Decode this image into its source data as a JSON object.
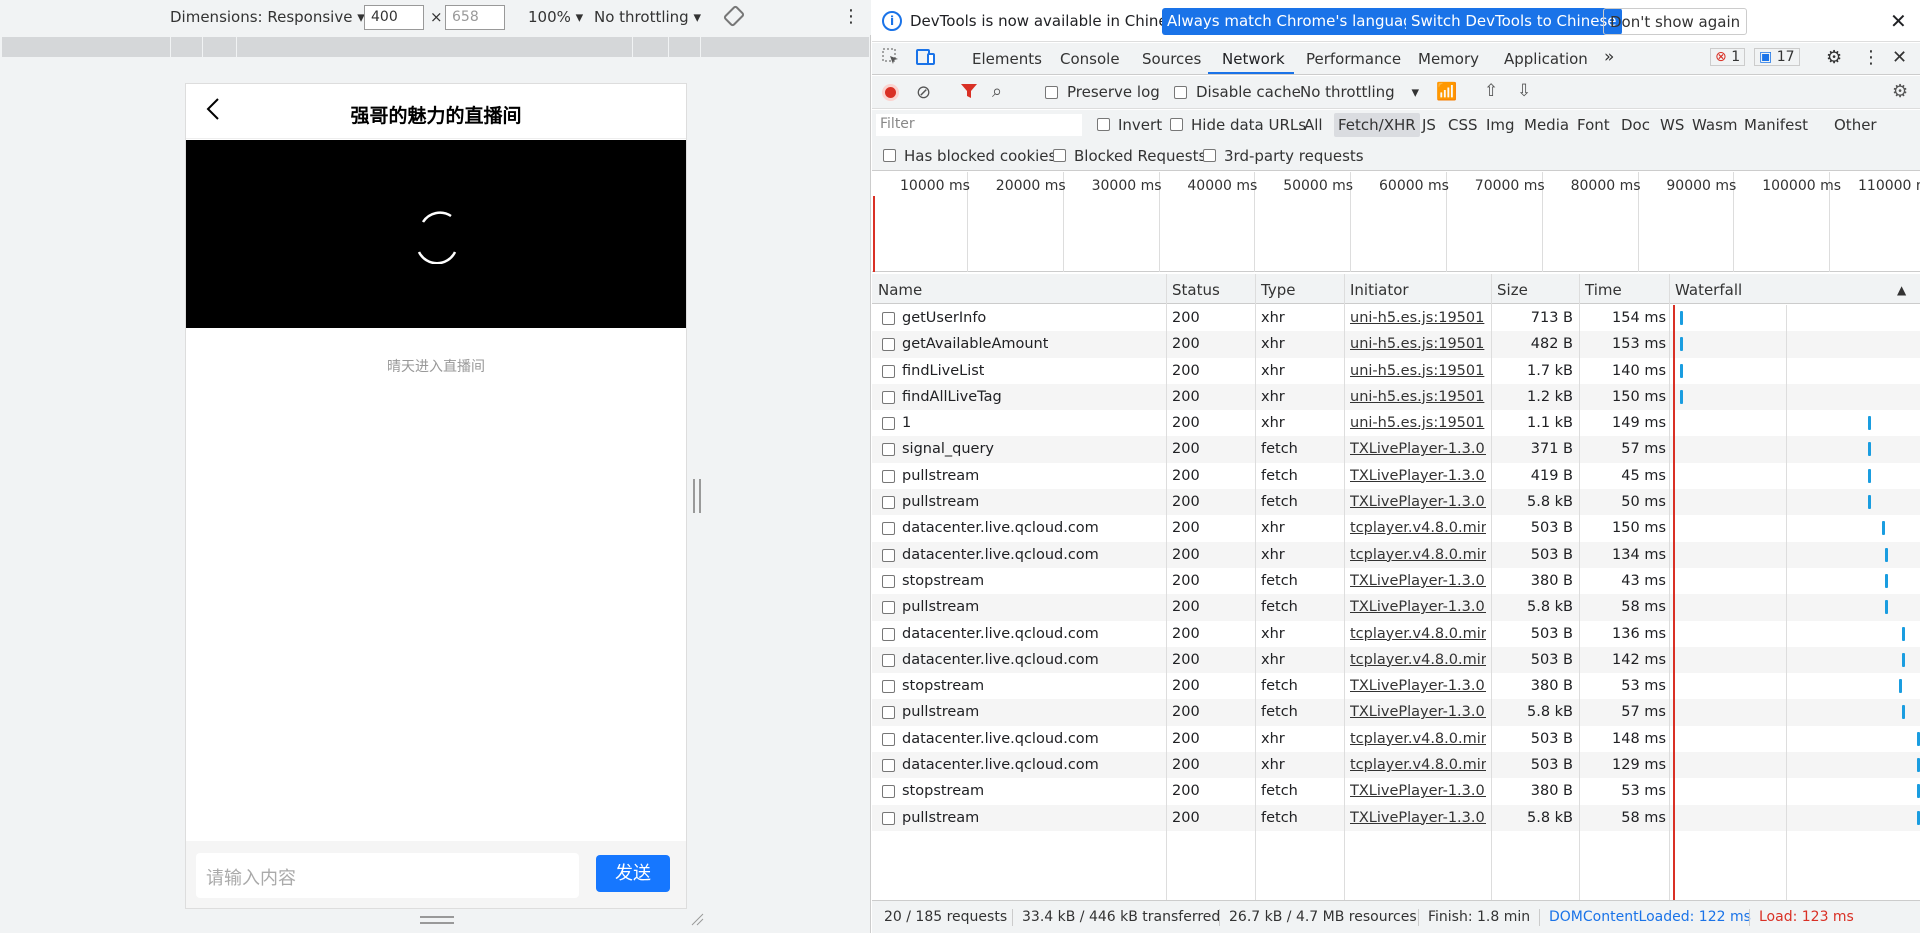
{
  "device_toolbar": {
    "dimensions_label": "Dimensions: Responsive",
    "width_value": "400",
    "height_placeholder": "658",
    "times": "×",
    "zoom": "100%",
    "throttling": "No throttling"
  },
  "phone": {
    "title": "强哥的魅力的直播间",
    "message": "晴天进入直播间",
    "input_placeholder": "请输入内容",
    "send_label": "发送"
  },
  "infobar": {
    "text": "DevTools is now available in Chinese!",
    "btn_match": "Always match Chrome's language",
    "btn_switch": "Switch DevTools to Chinese",
    "btn_dismiss": "Don't show again"
  },
  "tabs": [
    "Elements",
    "Console",
    "Sources",
    "Network",
    "Performance",
    "Memory",
    "Application"
  ],
  "active_tab": "Network",
  "errors_count": "1",
  "messages_count": "17",
  "network_toolbar": {
    "preserve_log": "Preserve log",
    "disable_cache": "Disable cache",
    "throttling": "No throttling"
  },
  "filter": {
    "placeholder": "Filter",
    "invert": "Invert",
    "hide_data_urls": "Hide data URLs",
    "types": [
      "All",
      "Fetch/XHR",
      "JS",
      "CSS",
      "Img",
      "Media",
      "Font",
      "Doc",
      "WS",
      "Wasm",
      "Manifest",
      "Other"
    ],
    "active_type": "Fetch/XHR",
    "has_blocked_cookies": "Has blocked cookies",
    "blocked_requests": "Blocked Requests",
    "third_party": "3rd-party requests"
  },
  "overview_ticks": [
    "10000 ms",
    "20000 ms",
    "30000 ms",
    "40000 ms",
    "50000 ms",
    "60000 ms",
    "70000 ms",
    "80000 ms",
    "90000 ms",
    "100000 ms",
    "110000 ms"
  ],
  "columns": {
    "name": "Name",
    "status": "Status",
    "type": "Type",
    "initiator": "Initiator",
    "size": "Size",
    "time": "Time",
    "waterfall": "Waterfall"
  },
  "requests": [
    {
      "name": "getUserInfo",
      "status": "200",
      "type": "xhr",
      "initiator": "uni-h5.es.js:19501",
      "size": "713 B",
      "time": "154 ms",
      "wf": 0.02
    },
    {
      "name": "getAvailableAmount",
      "status": "200",
      "type": "xhr",
      "initiator": "uni-h5.es.js:19501",
      "size": "482 B",
      "time": "153 ms",
      "wf": 0.02
    },
    {
      "name": "findLiveList",
      "status": "200",
      "type": "xhr",
      "initiator": "uni-h5.es.js:19501",
      "size": "1.7 kB",
      "time": "140 ms",
      "wf": 0.02
    },
    {
      "name": "findAllLiveTag",
      "status": "200",
      "type": "xhr",
      "initiator": "uni-h5.es.js:19501",
      "size": "1.2 kB",
      "time": "150 ms",
      "wf": 0.02
    },
    {
      "name": "1",
      "status": "200",
      "type": "xhr",
      "initiator": "uni-h5.es.js:19501",
      "size": "1.1 kB",
      "time": "149 ms",
      "wf": 0.79
    },
    {
      "name": "signal_query",
      "status": "200",
      "type": "fetch",
      "initiator": "TXLivePlayer-1.3.0....",
      "size": "371 B",
      "time": "57 ms",
      "wf": 0.79
    },
    {
      "name": "pullstream",
      "status": "200",
      "type": "fetch",
      "initiator": "TXLivePlayer-1.3.0....",
      "size": "419 B",
      "time": "45 ms",
      "wf": 0.79
    },
    {
      "name": "pullstream",
      "status": "200",
      "type": "fetch",
      "initiator": "TXLivePlayer-1.3.0....",
      "size": "5.8 kB",
      "time": "50 ms",
      "wf": 0.79
    },
    {
      "name": "datacenter.live.qcloud.com",
      "status": "200",
      "type": "xhr",
      "initiator": "tcplayer.v4.8.0.min....",
      "size": "503 B",
      "time": "150 ms",
      "wf": 0.85
    },
    {
      "name": "datacenter.live.qcloud.com",
      "status": "200",
      "type": "xhr",
      "initiator": "tcplayer.v4.8.0.min....",
      "size": "503 B",
      "time": "134 ms",
      "wf": 0.86
    },
    {
      "name": "stopstream",
      "status": "200",
      "type": "fetch",
      "initiator": "TXLivePlayer-1.3.0....",
      "size": "380 B",
      "time": "43 ms",
      "wf": 0.86
    },
    {
      "name": "pullstream",
      "status": "200",
      "type": "fetch",
      "initiator": "TXLivePlayer-1.3.0....",
      "size": "5.8 kB",
      "time": "58 ms",
      "wf": 0.86
    },
    {
      "name": "datacenter.live.qcloud.com",
      "status": "200",
      "type": "xhr",
      "initiator": "tcplayer.v4.8.0.min....",
      "size": "503 B",
      "time": "136 ms",
      "wf": 0.93
    },
    {
      "name": "datacenter.live.qcloud.com",
      "status": "200",
      "type": "xhr",
      "initiator": "tcplayer.v4.8.0.min....",
      "size": "503 B",
      "time": "142 ms",
      "wf": 0.93
    },
    {
      "name": "stopstream",
      "status": "200",
      "type": "fetch",
      "initiator": "TXLivePlayer-1.3.0....",
      "size": "380 B",
      "time": "53 ms",
      "wf": 0.92
    },
    {
      "name": "pullstream",
      "status": "200",
      "type": "fetch",
      "initiator": "TXLivePlayer-1.3.0....",
      "size": "5.8 kB",
      "time": "57 ms",
      "wf": 0.93
    },
    {
      "name": "datacenter.live.qcloud.com",
      "status": "200",
      "type": "xhr",
      "initiator": "tcplayer.v4.8.0.min....",
      "size": "503 B",
      "time": "148 ms",
      "wf": 0.99
    },
    {
      "name": "datacenter.live.qcloud.com",
      "status": "200",
      "type": "xhr",
      "initiator": "tcplayer.v4.8.0.min....",
      "size": "503 B",
      "time": "129 ms",
      "wf": 0.99
    },
    {
      "name": "stopstream",
      "status": "200",
      "type": "fetch",
      "initiator": "TXLivePlayer-1.3.0....",
      "size": "380 B",
      "time": "53 ms",
      "wf": 0.99
    },
    {
      "name": "pullstream",
      "status": "200",
      "type": "fetch",
      "initiator": "TXLivePlayer-1.3.0....",
      "size": "5.8 kB",
      "time": "58 ms",
      "wf": 0.99
    }
  ],
  "statusbar": {
    "requests": "20 / 185 requests",
    "transferred": "33.4 kB / 446 kB transferred",
    "resources": "26.7 kB / 4.7 MB resources",
    "finish": "Finish: 1.8 min",
    "domcontentloaded": "DOMContentLoaded: 122 ms",
    "load": "Load: 123 ms"
  },
  "colors": {
    "accent": "#1a73e8",
    "send_button": "#1677ff",
    "error": "#d93025",
    "waterfall": "#1a9de0"
  }
}
